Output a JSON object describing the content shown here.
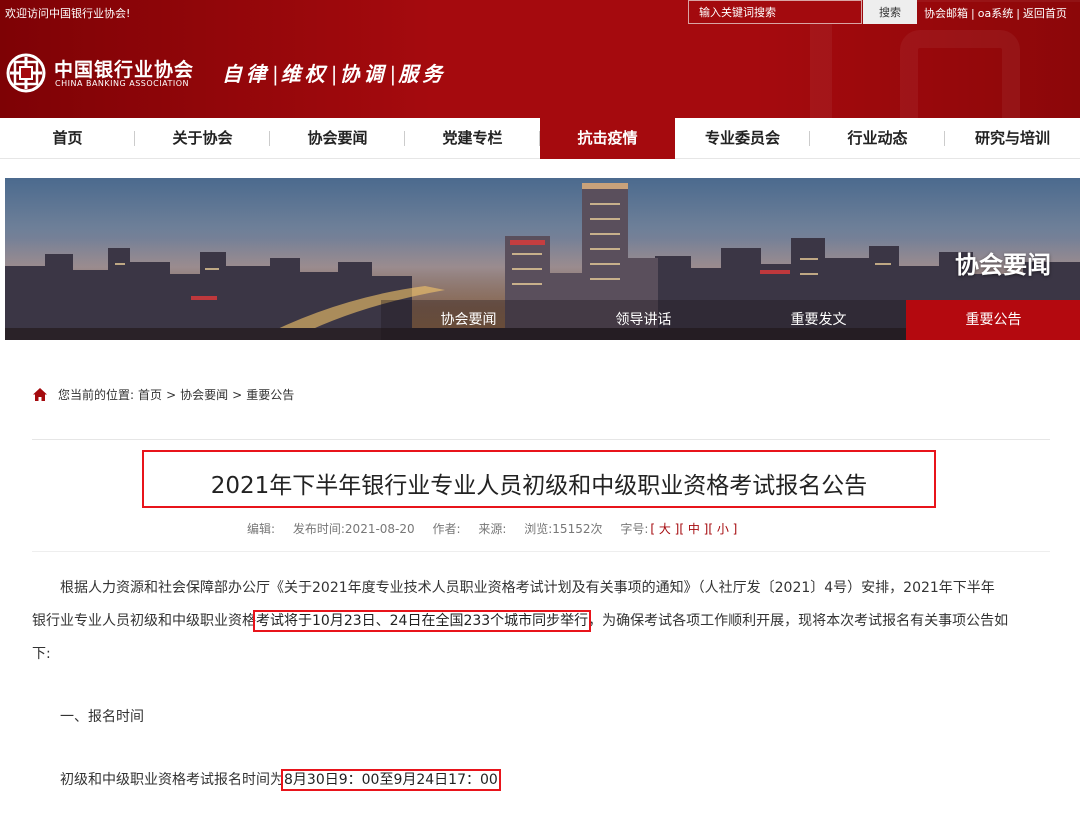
{
  "topbar": {
    "welcome": "欢迎访问中国银行业协会!",
    "search_placeholder": "输入关键词搜索",
    "search_button": "搜索",
    "links": [
      "协会邮箱",
      "oa系统",
      "返回首页"
    ],
    "separator": "|"
  },
  "brand": {
    "name_cn": "中国银行业协会",
    "name_en": "CHINA BANKING ASSOCIATION",
    "slogan": [
      "自律",
      "维权",
      "协调",
      "服务"
    ],
    "slogan_separator": "|",
    "color_primary": "#a50a0e",
    "color_highlight": "#e8141b"
  },
  "nav": {
    "items": [
      "首页",
      "关于协会",
      "协会要闻",
      "党建专栏",
      "抗击疫情",
      "专业委员会",
      "行业动态",
      "研究与培训"
    ],
    "active_index": 4
  },
  "banner": {
    "title": "协会要闻",
    "subnav": [
      "协会要闻",
      "领导讲话",
      "重要发文",
      "重要公告"
    ],
    "active_index": 3
  },
  "breadcrumb": {
    "icon": "home-icon",
    "prefix": "您当前的位置:",
    "items": [
      "首页",
      "协会要闻",
      "重要公告"
    ],
    "separator": ">"
  },
  "article": {
    "title": "2021年下半年银行业专业人员初级和中级职业资格考试报名公告",
    "meta": {
      "editor_label": "编辑:",
      "publish_label": "发布时间:",
      "publish_date": "2021-08-20",
      "author_label": "作者:",
      "source_label": "来源:",
      "views_label": "浏览:",
      "views": "15152次",
      "fontsize_label": "字号:",
      "fontsize_options": [
        "[ 大 ]",
        "[ 中 ]",
        "[ 小 ]"
      ]
    },
    "paragraph1": {
      "line1": "根据人力资源和社会保障部办公厅《关于2021年度专业技术人员职业资格考试计划及有关事项的通知》（人社厅发〔2021〕4号）安排，2021年下半年",
      "line2_before": "银行业专业人员初级和中级职业资格",
      "line2_highlight": "考试将于10月23日、24日在全国233个城市同步举行",
      "line2_after": "，为确保考试各项工作顺利开展，现将本次考试报名有关事项公告如",
      "line3": "下:"
    },
    "section1_heading": "一、报名时间",
    "section1_text_before": "初级和中级职业资格考试报名时间为",
    "section1_highlight": "8月30日9：00至9月24日17：00"
  }
}
